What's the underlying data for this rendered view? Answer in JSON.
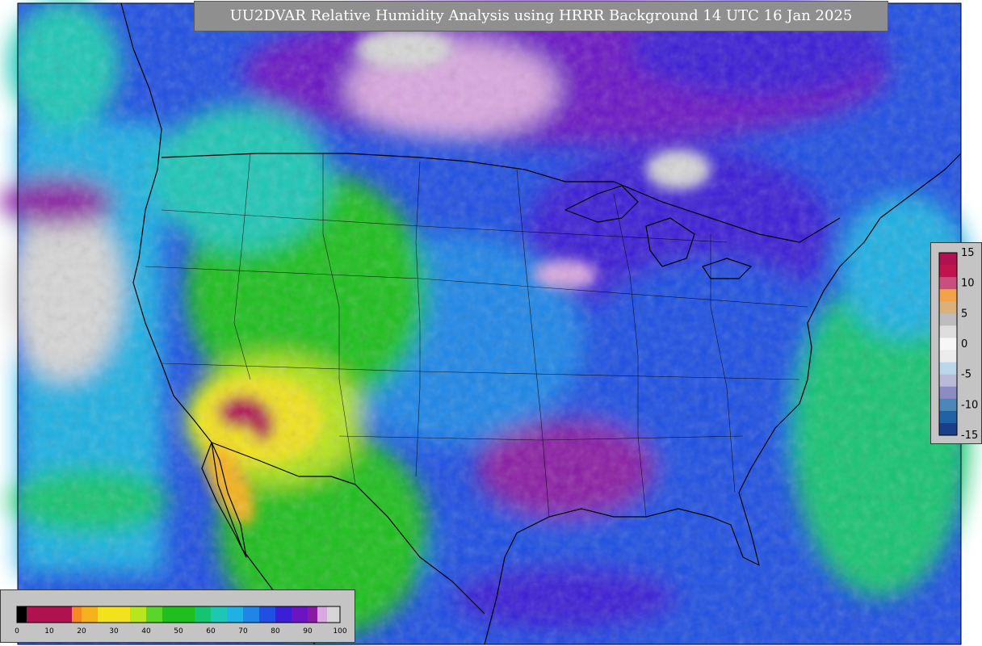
{
  "title": "UU2DVAR Relative Humidity Analysis using HRRR Background 14 UTC 16 Jan 2025",
  "rh_colorbar": {
    "ticks": [
      "0",
      "10",
      "20",
      "30",
      "40",
      "50",
      "60",
      "70",
      "80",
      "90",
      "100"
    ],
    "range": [
      0,
      100
    ],
    "stops": [
      {
        "from": 0,
        "to": 3,
        "color": "#000000"
      },
      {
        "from": 3,
        "to": 17,
        "color": "#b0114f"
      },
      {
        "from": 17,
        "to": 20,
        "color": "#f58a24"
      },
      {
        "from": 20,
        "to": 25,
        "color": "#f6b21d"
      },
      {
        "from": 25,
        "to": 35,
        "color": "#f2e21b"
      },
      {
        "from": 35,
        "to": 40,
        "color": "#b7e51f"
      },
      {
        "from": 40,
        "to": 45,
        "color": "#5ad62a"
      },
      {
        "from": 45,
        "to": 55,
        "color": "#1fbf1f"
      },
      {
        "from": 55,
        "to": 60,
        "color": "#14c471"
      },
      {
        "from": 60,
        "to": 65,
        "color": "#1ec7b5"
      },
      {
        "from": 65,
        "to": 70,
        "color": "#1fb1e3"
      },
      {
        "from": 70,
        "to": 75,
        "color": "#1f86e8"
      },
      {
        "from": 75,
        "to": 80,
        "color": "#1f4fe3"
      },
      {
        "from": 80,
        "to": 85,
        "color": "#3b1fd6"
      },
      {
        "from": 85,
        "to": 90,
        "color": "#6a14c4"
      },
      {
        "from": 90,
        "to": 93,
        "color": "#8a1aa4"
      },
      {
        "from": 93,
        "to": 96,
        "color": "#d9a8e0"
      },
      {
        "from": 96,
        "to": 100,
        "color": "#d6d6d6"
      }
    ]
  },
  "diff_colorbar": {
    "ticks": [
      "15",
      "10",
      "5",
      "0",
      "-5",
      "-10",
      "-15"
    ],
    "range": [
      -15,
      15
    ],
    "stops": [
      {
        "from": 13,
        "to": 15,
        "color": "#b0114f"
      },
      {
        "from": 11,
        "to": 13,
        "color": "#c0144f"
      },
      {
        "from": 9,
        "to": 11,
        "color": "#c9507e"
      },
      {
        "from": 7,
        "to": 9,
        "color": "#f2a24a"
      },
      {
        "from": 5,
        "to": 7,
        "color": "#dcb07a"
      },
      {
        "from": 3,
        "to": 5,
        "color": "#bdbdbd"
      },
      {
        "from": 1,
        "to": 3,
        "color": "#dedede"
      },
      {
        "from": -1,
        "to": 1,
        "color": "#f7f7f7"
      },
      {
        "from": -3,
        "to": -1,
        "color": "#ececec"
      },
      {
        "from": -5,
        "to": -3,
        "color": "#b8d8ea"
      },
      {
        "from": -7,
        "to": -5,
        "color": "#b9b9d8"
      },
      {
        "from": -9,
        "to": -7,
        "color": "#8c8cc2"
      },
      {
        "from": -11,
        "to": -9,
        "color": "#4d86b8"
      },
      {
        "from": -13,
        "to": -11,
        "color": "#2062a6"
      },
      {
        "from": -15,
        "to": -13,
        "color": "#1a3f8a"
      }
    ]
  },
  "colors": {
    "ocean": "#1f86e8",
    "land_moist": "#3b1fd6",
    "land_dry": "#1fbf1f",
    "desert": "#f2e21b",
    "very_dry": "#b0114f",
    "saturated": "#d6d6d6",
    "boundary": "#000000",
    "title_bg": "#8f8f8f"
  }
}
